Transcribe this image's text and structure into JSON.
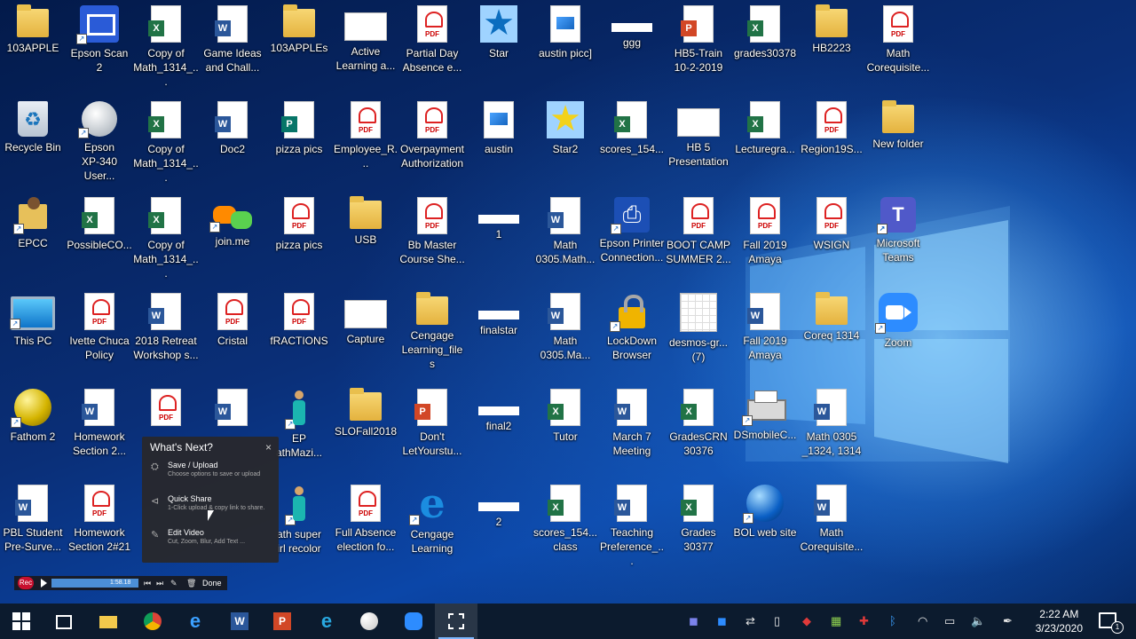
{
  "desktop_icons": [
    {
      "label": "103APPLE",
      "type": "folder"
    },
    {
      "label": "Epson Scan 2",
      "type": "scan"
    },
    {
      "label": "Copy of\nMath_1314_...",
      "type": "excel"
    },
    {
      "label": "Game Ideas\nand Chall...",
      "type": "word"
    },
    {
      "label": "103APPLEs",
      "type": "folder"
    },
    {
      "label": "Active\nLearning a...",
      "type": "thumb"
    },
    {
      "label": "Partial Day\nAbsence e...",
      "type": "pdf"
    },
    {
      "label": "Star",
      "type": "star"
    },
    {
      "label": "austin picc]",
      "type": "image"
    },
    {
      "label": "ggg",
      "type": "thumbsmall"
    },
    {
      "label": "HB5-Train\n10-2-2019",
      "type": "ppt"
    },
    {
      "label": "grades30378",
      "type": "excel"
    },
    {
      "label": "HB2223",
      "type": "folder"
    },
    {
      "label": "Math\nCorequisite...",
      "type": "pdf"
    },
    {
      "label": "Recycle Bin",
      "type": "recycle"
    },
    {
      "label": "Epson\nXP-340 User...",
      "type": "epson"
    },
    {
      "label": "Copy of\nMath_1314_...",
      "type": "excel"
    },
    {
      "label": "Doc2",
      "type": "word"
    },
    {
      "label": "pizza pics",
      "type": "pub"
    },
    {
      "label": "Employee_R...",
      "type": "pdf"
    },
    {
      "label": "Overpayment\nAuthorization",
      "type": "pdf"
    },
    {
      "label": "austin",
      "type": "image"
    },
    {
      "label": "Star2",
      "type": "star2"
    },
    {
      "label": "scores_154...",
      "type": "excel"
    },
    {
      "label": "HB 5\nPresentation",
      "type": "thumb"
    },
    {
      "label": "Lecturegra...",
      "type": "excel"
    },
    {
      "label": "Region19S...",
      "type": "pdf"
    },
    {
      "label": "New folder",
      "type": "folder"
    },
    {
      "label": "EPCC",
      "type": "person"
    },
    {
      "label": "PossibleCO...",
      "type": "excel"
    },
    {
      "label": "Copy of\nMath_1314_...",
      "type": "excel"
    },
    {
      "label": "join.me",
      "type": "join"
    },
    {
      "label": "pizza pics",
      "type": "pdf"
    },
    {
      "label": "USB",
      "type": "folder"
    },
    {
      "label": "Bb Master\nCourse She...",
      "type": "pdf"
    },
    {
      "label": "1",
      "type": "thumbsmall"
    },
    {
      "label": "Math\n0305.Math...",
      "type": "word"
    },
    {
      "label": "Epson Printer\nConnection...",
      "type": "epsonprinter"
    },
    {
      "label": "BOOT CAMP\nSUMMER 2...",
      "type": "pdf"
    },
    {
      "label": "Fall 2019\nAmaya",
      "type": "pdf"
    },
    {
      "label": "WSIGN",
      "type": "pdf"
    },
    {
      "label": "Microsoft\nTeams",
      "type": "teams"
    },
    {
      "label": "This PC",
      "type": "pc"
    },
    {
      "label": "Ivette Chuca\nPolicy",
      "type": "pdf"
    },
    {
      "label": "2018 Retreat\nWorkshop s...",
      "type": "word"
    },
    {
      "label": "Cristal",
      "type": "pdf"
    },
    {
      "label": "fRACTIONS",
      "type": "pdf"
    },
    {
      "label": "Capture",
      "type": "thumb"
    },
    {
      "label": "Cengage\nLearning_files",
      "type": "folder"
    },
    {
      "label": "finalstar",
      "type": "thumbsmall"
    },
    {
      "label": "Math\n0305.Ma...",
      "type": "word"
    },
    {
      "label": "LockDown\nBrowser",
      "type": "lock"
    },
    {
      "label": "desmos-gr...\n(7)",
      "type": "desmos"
    },
    {
      "label": "Fall 2019\nAmaya",
      "type": "word"
    },
    {
      "label": "Coreq 1314",
      "type": "folder"
    },
    {
      "label": "Zoom",
      "type": "zoom"
    },
    {
      "label": "Fathom 2",
      "type": "fathom"
    },
    {
      "label": "Homework\nSection 2...",
      "type": "word"
    },
    {
      "label": "",
      "type": "pdf"
    },
    {
      "label": "",
      "type": "word"
    },
    {
      "label": "EP\nathMazi...",
      "type": "figure"
    },
    {
      "label": "SLOFall2018",
      "type": "folder"
    },
    {
      "label": "Don't\nLetYourstu...",
      "type": "ppt"
    },
    {
      "label": "final2",
      "type": "thumbsmall"
    },
    {
      "label": "Tutor",
      "type": "excel"
    },
    {
      "label": "March 7\nMeeting",
      "type": "word"
    },
    {
      "label": "GradesCRN\n30376",
      "type": "excel"
    },
    {
      "label": "DSmobileC...",
      "type": "printer"
    },
    {
      "label": "Math 0305\n_1324, 1314",
      "type": "word"
    },
    {
      "label": "PBL Student\nPre-Surve...",
      "type": "word"
    },
    {
      "label": "Homework\nSection 2#21",
      "type": "pdf"
    },
    {
      "label": "",
      "type": "none"
    },
    {
      "label": "ath super\nirl recolor",
      "type": "figure"
    },
    {
      "label": "Full Absence\nelection fo...",
      "type": "pdf"
    },
    {
      "label": "Cengage\nLearning",
      "type": "cengage"
    },
    {
      "label": "2",
      "type": "thumbsmall"
    },
    {
      "label": "scores_154...\nclass",
      "type": "excel"
    },
    {
      "label": "Teaching\nPreference_...",
      "type": "word"
    },
    {
      "label": "Grades 30377",
      "type": "excel"
    },
    {
      "label": "BOL web site",
      "type": "globe"
    },
    {
      "label": "Math\nCorequisite...",
      "type": "word"
    }
  ],
  "popup": {
    "title": "What's Next?",
    "close": "×",
    "items": [
      {
        "title": "Save / Upload",
        "sub": "Choose options to save or upload",
        "icon": "save-icon"
      },
      {
        "title": "Quick Share",
        "sub": "1-Click upload & copy link to share.",
        "icon": "share-icon"
      },
      {
        "title": "Edit Video",
        "sub": "Cut, Zoom, Blur, Add Text ...",
        "icon": "edit-icon"
      }
    ]
  },
  "recorder": {
    "rec": "Rec",
    "time": "1:58.18",
    "done": "Done"
  },
  "taskbar": {
    "apps": [
      "start",
      "task-view",
      "file-explorer",
      "chrome",
      "edge",
      "word",
      "powerpoint",
      "internet-explorer",
      "paint",
      "zoom",
      "snipping"
    ],
    "time": "2:22 AM",
    "date": "3/23/2020",
    "notifications": "1"
  }
}
